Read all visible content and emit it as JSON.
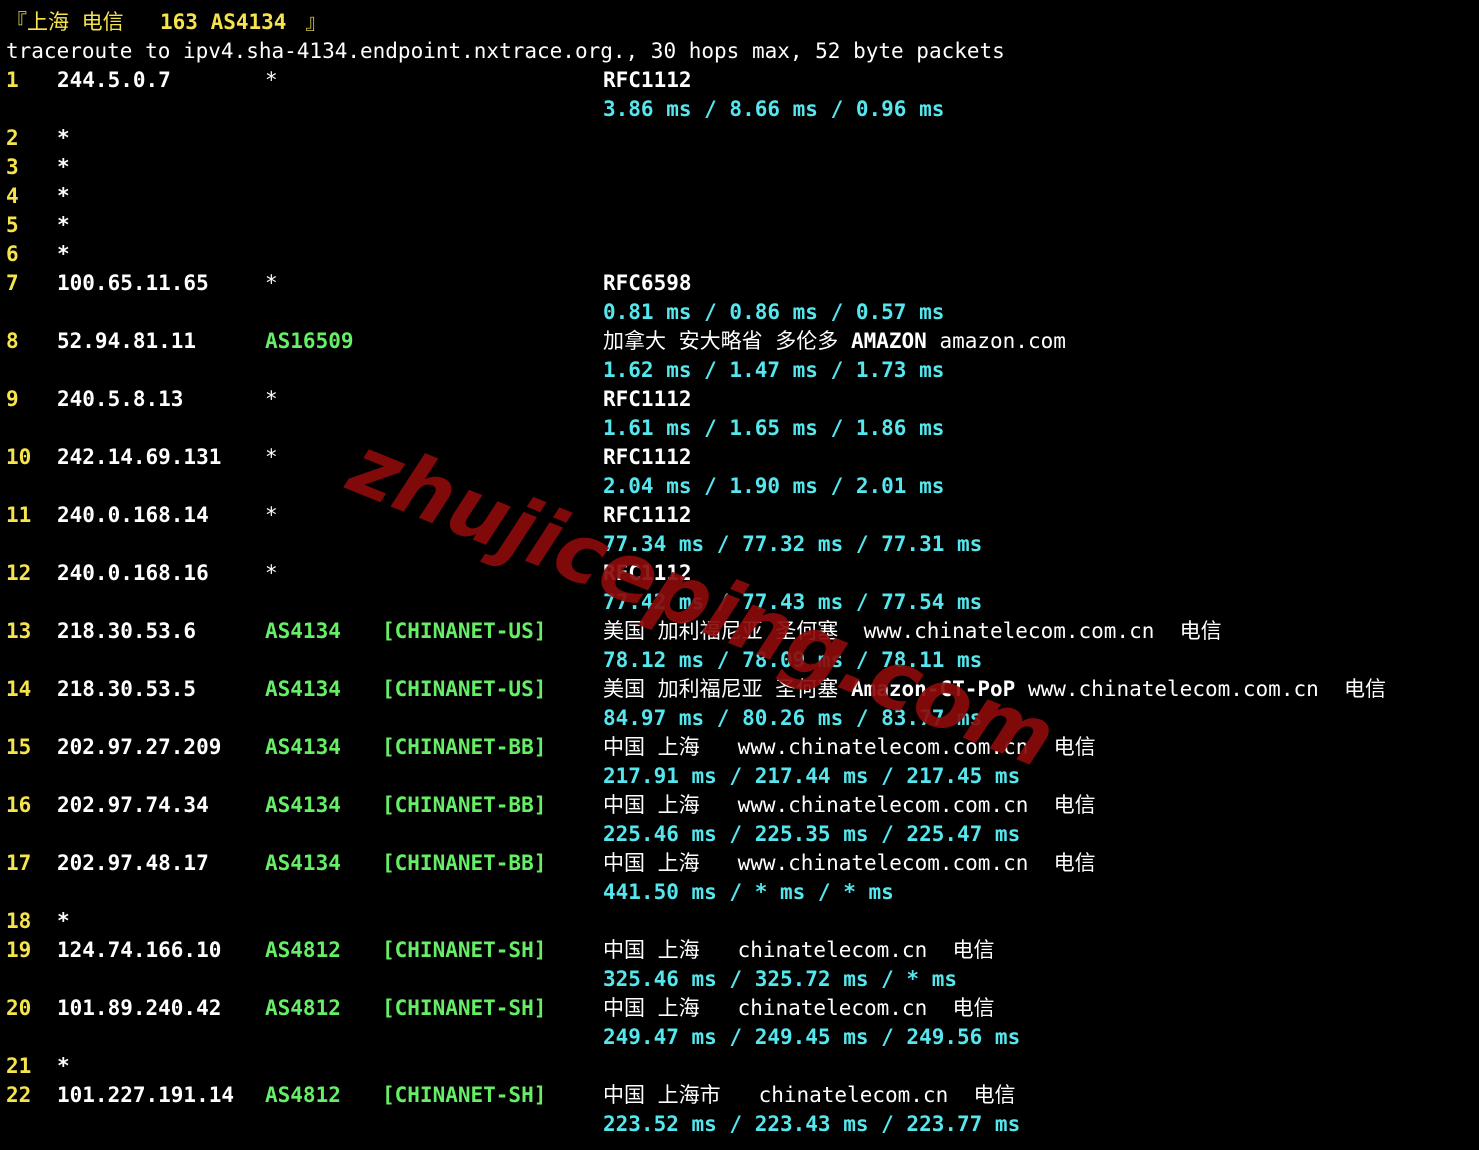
{
  "header": {
    "location": "『上海 电信 ",
    "asn": "163 AS4134",
    "suffix": " 』",
    "command": "traceroute to ipv4.sha-4134.endpoint.nxtrace.org., 30 hops max, 52 byte packets"
  },
  "watermark": "zhujiceping.com",
  "hops": [
    {
      "n": "1",
      "ip": "244.5.0.7",
      "asn": "*",
      "tag": "",
      "geo": "RFC1112",
      "lat": "3.86 ms / 8.66 ms / 0.96 ms",
      "geoBold": true
    },
    {
      "n": "2",
      "ip": "*"
    },
    {
      "n": "3",
      "ip": "*"
    },
    {
      "n": "4",
      "ip": "*"
    },
    {
      "n": "5",
      "ip": "*"
    },
    {
      "n": "6",
      "ip": "*"
    },
    {
      "n": "7",
      "ip": "100.65.11.65",
      "asn": "*",
      "tag": "",
      "geo": "RFC6598",
      "lat": "0.81 ms / 0.86 ms / 0.57 ms",
      "geoBold": true
    },
    {
      "n": "8",
      "ip": "52.94.81.11",
      "asn": "AS16509",
      "tag": "",
      "geo": "加拿大 安大略省 多伦多 ",
      "geoB": "AMAZON",
      "geoC": " amazon.com",
      "lat": "1.62 ms / 1.47 ms / 1.73 ms"
    },
    {
      "n": "9",
      "ip": "240.5.8.13",
      "asn": "*",
      "tag": "",
      "geo": "RFC1112",
      "lat": "1.61 ms / 1.65 ms / 1.86 ms",
      "geoBold": true
    },
    {
      "n": "10",
      "ip": "242.14.69.131",
      "asn": "*",
      "tag": "",
      "geo": "RFC1112",
      "lat": "2.04 ms / 1.90 ms / 2.01 ms",
      "geoBold": true
    },
    {
      "n": "11",
      "ip": "240.0.168.14",
      "asn": "*",
      "tag": "",
      "geo": "RFC1112",
      "lat": "77.34 ms / 77.32 ms / 77.31 ms",
      "geoBold": true
    },
    {
      "n": "12",
      "ip": "240.0.168.16",
      "asn": "*",
      "tag": "",
      "geo": "RFC1112",
      "lat": "77.42 ms / 77.43 ms / 77.54 ms",
      "geoBold": true
    },
    {
      "n": "13",
      "ip": "218.30.53.6",
      "asn": "AS4134",
      "tag": "[CHINANET-US]",
      "geo": "美国 加利福尼亚 圣何塞  www.chinatelecom.com.cn  电信",
      "lat": "78.12 ms / 78.09 ms / 78.11 ms"
    },
    {
      "n": "14",
      "ip": "218.30.53.5",
      "asn": "AS4134",
      "tag": "[CHINANET-US]",
      "geo": "美国 加利福尼亚 圣何塞 ",
      "geoB": "Amazon-CT-PoP",
      "geoC": " www.chinatelecom.com.cn  电信",
      "lat": "84.97 ms / 80.26 ms / 83.77 ms"
    },
    {
      "n": "15",
      "ip": "202.97.27.209",
      "asn": "AS4134",
      "tag": "[CHINANET-BB]",
      "geo": "中国 上海   www.chinatelecom.com.cn  电信",
      "lat": "217.91 ms / 217.44 ms / 217.45 ms"
    },
    {
      "n": "16",
      "ip": "202.97.74.34",
      "asn": "AS4134",
      "tag": "[CHINANET-BB]",
      "geo": "中国 上海   www.chinatelecom.com.cn  电信",
      "lat": "225.46 ms / 225.35 ms / 225.47 ms"
    },
    {
      "n": "17",
      "ip": "202.97.48.17",
      "asn": "AS4134",
      "tag": "[CHINANET-BB]",
      "geo": "中国 上海   www.chinatelecom.com.cn  电信",
      "lat": "441.50 ms / * ms / * ms"
    },
    {
      "n": "18",
      "ip": "*"
    },
    {
      "n": "19",
      "ip": "124.74.166.10",
      "asn": "AS4812",
      "tag": "[CHINANET-SH]",
      "geo": "中国 上海   chinatelecom.cn  电信",
      "lat": "325.46 ms / 325.72 ms / * ms"
    },
    {
      "n": "20",
      "ip": "101.89.240.42",
      "asn": "AS4812",
      "tag": "[CHINANET-SH]",
      "geo": "中国 上海   chinatelecom.cn  电信",
      "lat": "249.47 ms / 249.45 ms / 249.56 ms"
    },
    {
      "n": "21",
      "ip": "*"
    },
    {
      "n": "22",
      "ip": "101.227.191.14",
      "asn": "AS4812",
      "tag": "[CHINANET-SH]",
      "geo": "中国 上海市   chinatelecom.cn  电信",
      "lat": "223.52 ms / 223.43 ms / 223.77 ms"
    }
  ],
  "colors": {
    "background": "#000000",
    "hop": "#f5e44c",
    "asn": "#66ee66",
    "latency": "#55e6ee",
    "text": "#ffffff",
    "watermark": "#8b0a0a"
  }
}
